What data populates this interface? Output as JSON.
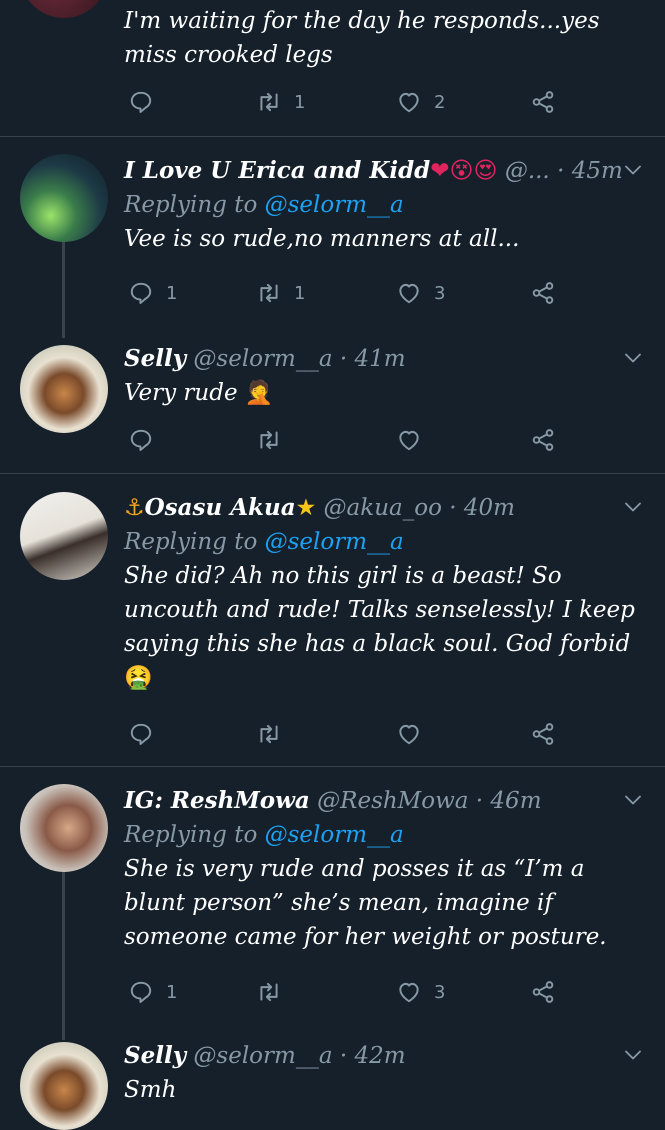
{
  "tweets": [
    {
      "name": "",
      "handle": "",
      "time": "",
      "replying_label": "",
      "replying_to": "",
      "text": "I'm waiting for the day he responds...yes miss crooked legs",
      "reply_count": "",
      "retweet_count": "1",
      "like_count": "2"
    },
    {
      "name": "I Love U Erica and Kidd",
      "name_emoji": "❤😵😍",
      "handle": "@...",
      "dot": "·",
      "time": "45m",
      "replying_label": "Replying to",
      "replying_to": "@selorm__a",
      "text": "Vee is so rude,no manners at all...",
      "reply_count": "1",
      "retweet_count": "1",
      "like_count": "3"
    },
    {
      "name": "Selly",
      "handle": "@selorm__a",
      "dot": "·",
      "time": "41m",
      "text": "Very rude",
      "text_emoji": "🤦",
      "reply_count": "",
      "retweet_count": "",
      "like_count": ""
    },
    {
      "name_prefix": "⚓",
      "name": "Osasu Akua",
      "name_emoji": "★",
      "handle": "@akua_oo",
      "dot": "·",
      "time": "40m",
      "replying_label": "Replying to",
      "replying_to": "@selorm__a",
      "text": "She did? Ah no this girl is a beast! So uncouth and rude! Talks senselessly! I keep saying this she has a black soul. God forbid",
      "text_emoji": "🤮",
      "reply_count": "",
      "retweet_count": "",
      "like_count": ""
    },
    {
      "name": "IG: ReshMowa",
      "handle": "@ReshMowa",
      "dot": "·",
      "time": "46m",
      "replying_label": "Replying to",
      "replying_to": "@selorm__a",
      "text": "She is very rude and posses it as “I’m a blunt person” she’s mean, imagine if someone came for her weight or posture.",
      "reply_count": "1",
      "retweet_count": "",
      "like_count": "3"
    },
    {
      "name": "Selly",
      "handle": "@selorm__a",
      "dot": "·",
      "time": "42m",
      "text": "Smh"
    }
  ],
  "colors": {
    "background": "#15202b",
    "divider": "#38444d",
    "muted": "#8899a6",
    "accent": "#1da1f2"
  },
  "icons": [
    "reply-icon",
    "retweet-icon",
    "like-icon",
    "share-icon",
    "chevron-down-icon"
  ]
}
